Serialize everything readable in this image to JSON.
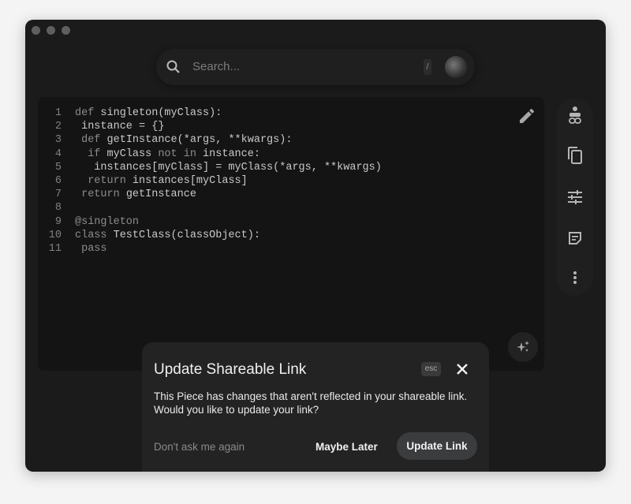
{
  "search": {
    "placeholder": "Search...",
    "shortcut": "/"
  },
  "code": [
    {
      "n": "1",
      "t": [
        [
          "kw",
          "def "
        ],
        [
          "id",
          "singleton(myClass):"
        ]
      ]
    },
    {
      "n": "2",
      "t": [
        [
          "id",
          " instance = {}"
        ]
      ]
    },
    {
      "n": "3",
      "t": [
        [
          "kw",
          " def "
        ],
        [
          "id",
          "getInstance(*args, **kwargs):"
        ]
      ]
    },
    {
      "n": "4",
      "t": [
        [
          "kw",
          "  if "
        ],
        [
          "id",
          "myClass "
        ],
        [
          "kw",
          "not in "
        ],
        [
          "id",
          "instance:"
        ]
      ]
    },
    {
      "n": "5",
      "t": [
        [
          "id",
          "   instances[myClass] = myClass(*args, **kwargs)"
        ]
      ]
    },
    {
      "n": "6",
      "t": [
        [
          "kw",
          "  return "
        ],
        [
          "id",
          "instances[myClass]"
        ]
      ]
    },
    {
      "n": "7",
      "t": [
        [
          "kw",
          " return "
        ],
        [
          "id",
          "getInstance"
        ]
      ]
    },
    {
      "n": "8",
      "t": []
    },
    {
      "n": "9",
      "t": [
        [
          "kw",
          "@singleton"
        ]
      ]
    },
    {
      "n": "10",
      "t": [
        [
          "kw",
          "class "
        ],
        [
          "id",
          "TestClass(classObject):"
        ]
      ]
    },
    {
      "n": "11",
      "t": [
        [
          "kw",
          " pass"
        ]
      ]
    }
  ],
  "dialog": {
    "title": "Update Shareable Link",
    "esc_label": "esc",
    "body": "This Piece has changes that aren't reflected in your shareable link. Would you like to update your link?",
    "dont_ask": "Don't ask me again",
    "maybe_later": "Maybe Later",
    "update": "Update Link"
  }
}
